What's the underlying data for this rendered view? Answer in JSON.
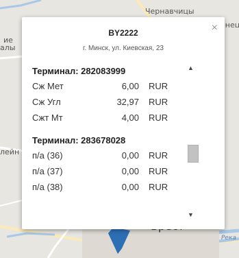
{
  "map": {
    "labels": [
      "Чернавчицы",
      "енец",
      "ие",
      "алы",
      "лейн",
      "Брест",
      "Река"
    ]
  },
  "popup": {
    "title": "BY2222",
    "address": "г. Минск, ул. Киевская, 23",
    "close_label": "×",
    "terminals": [
      {
        "header": "Терминал: 282083999",
        "rows": [
          {
            "name": "Сж Мет",
            "value": "6,00",
            "currency": "RUR"
          },
          {
            "name": "Сж Угл",
            "value": "32,97",
            "currency": "RUR"
          },
          {
            "name": "Сжт Мт",
            "value": "4,00",
            "currency": "RUR"
          }
        ]
      },
      {
        "header": "Терминал: 283678028",
        "rows": [
          {
            "name": "п/а (36)",
            "value": "0,00",
            "currency": "RUR"
          },
          {
            "name": "п/а (37)",
            "value": "0,00",
            "currency": "RUR"
          },
          {
            "name": "п/а (38)",
            "value": "0,00",
            "currency": "RUR"
          }
        ]
      }
    ]
  },
  "scrollbar": {
    "up_icon": "▲",
    "down_icon": "▼"
  },
  "colors": {
    "marker": "#2d6fb5",
    "water": "#a9c8e8",
    "road": "#f6d38a"
  }
}
